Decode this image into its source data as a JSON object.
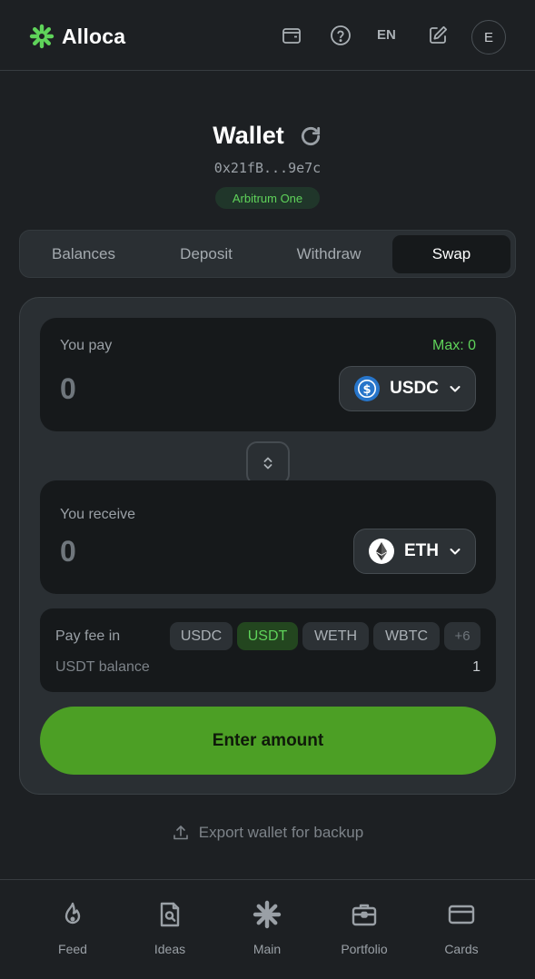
{
  "header": {
    "brand": "Alloca",
    "language": "EN",
    "avatar_initial": "E",
    "icons": [
      "wallet-icon",
      "help-icon",
      "edit-icon"
    ]
  },
  "wallet": {
    "title": "Wallet",
    "address": "0x21fB...9e7c",
    "network": "Arbitrum One"
  },
  "tabs": [
    {
      "label": "Balances",
      "active": false
    },
    {
      "label": "Deposit",
      "active": false
    },
    {
      "label": "Withdraw",
      "active": false
    },
    {
      "label": "Swap",
      "active": true
    }
  ],
  "swap": {
    "pay": {
      "label": "You pay",
      "max": "Max: 0",
      "amount": "0",
      "token": "USDC"
    },
    "receive": {
      "label": "You receive",
      "amount": "0",
      "token": "ETH"
    },
    "fee": {
      "label": "Pay fee in",
      "options": [
        {
          "label": "USDC",
          "active": false
        },
        {
          "label": "USDT",
          "active": true
        },
        {
          "label": "WETH",
          "active": false
        },
        {
          "label": "WBTC",
          "active": false
        },
        {
          "label": "+6",
          "active": false
        }
      ],
      "balance_label": "USDT balance",
      "balance_value": "1"
    },
    "cta": "Enter amount"
  },
  "export_label": "Export wallet for backup",
  "nav": [
    {
      "label": "Feed",
      "icon": "flame-icon"
    },
    {
      "label": "Ideas",
      "icon": "ideas-icon"
    },
    {
      "label": "Main",
      "icon": "asterisk-icon"
    },
    {
      "label": "Portfolio",
      "icon": "briefcase-icon"
    },
    {
      "label": "Cards",
      "icon": "card-icon"
    }
  ],
  "colors": {
    "background": "#1d2023",
    "accent": "#4c9f25",
    "accent_text": "#5fd35a",
    "usdc": "#2775ca"
  }
}
